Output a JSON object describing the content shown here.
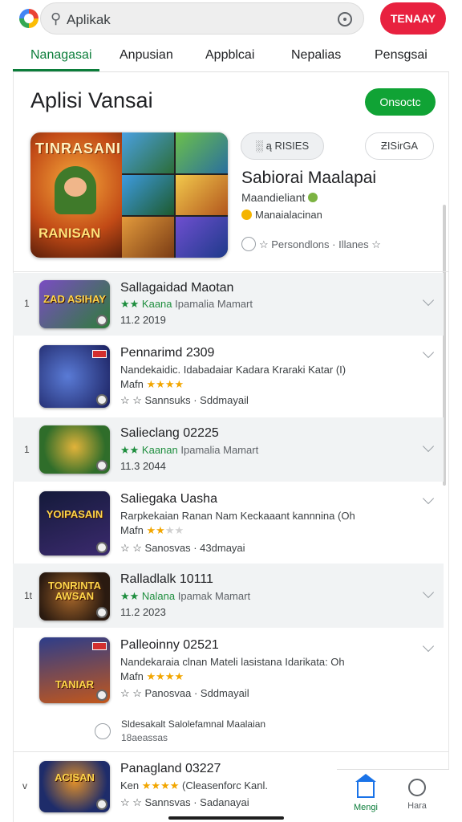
{
  "search": {
    "value": "Aplikak",
    "install_label": "TENAAY"
  },
  "tabs": [
    "Nanagasai",
    "Anpusian",
    "Appblcai",
    "Nepalias",
    "Pensgsai"
  ],
  "page": {
    "title": "Aplisi Vansai",
    "primary_button": "Onsoctc"
  },
  "featured": {
    "art_top": "TINRASANI",
    "art_bottom": "RANISAN",
    "pill_left": "░ ą RISIES",
    "pill_right": "ƵISirGA",
    "title": "Sabiorai Maalapai",
    "subtitle": "Maandieliant",
    "developer": "Manaialacinan",
    "meta": "☆  Persondlons  ·  Illanes ☆"
  },
  "list": [
    {
      "num": "1",
      "title": "Sallagaidad Maotan",
      "line1": "★★ Kaana",
      "line1b": "Ipamalia Mamart",
      "line2": "11.2 2019",
      "thumb": "ZAD ASIHAY"
    },
    {
      "num": "",
      "title": "Pennarimd 2309",
      "line1": "Nandekaidic. Idabadaiar Kadara Kraraki Katar (I)",
      "line1b": "",
      "stars_label": "Mafn",
      "stars": 4,
      "line2": "☆ ☆ Sannsuks  ·  Sddmayail",
      "thumb": ""
    },
    {
      "num": "1",
      "title": "Salieclang 02225",
      "line1": "★★ Kaanan",
      "line1b": "Ipamalia Mamart",
      "line2": "11.3 2044",
      "thumb": ""
    },
    {
      "num": "",
      "title": "Saliegaka Uasha",
      "line1": "Rarpkekaian Ranan Nam Keckaaant kannnina (Oh",
      "line1b": "",
      "stars_label": "Mafn",
      "stars": 2,
      "line2": "☆ ☆ Sanosvas  ·  43dmayai",
      "thumb": "YOIPASAIN"
    },
    {
      "num": "1t",
      "title": "Ralladlalk 10111",
      "line1": "★★ Nalana",
      "line1b": "Ipamak Mamart",
      "line2": "11.2 2023",
      "thumb": "TONRINTA AWSAN"
    },
    {
      "num": "",
      "title": "Palleoinny 02521",
      "line1": "Nandekaraia clnan Mateli lasistana Idarikata: Oh",
      "line1b": "",
      "stars_label": "Mafn",
      "stars": 4,
      "line2": "☆ ☆ Panosvaa  ·  Sddmayail",
      "thumb": "TANIAR"
    },
    {
      "num": "v",
      "title": "Panagland 03227",
      "line1": "Ken",
      "line1b": "(Cleasenforc Kanl.",
      "stars_label": "",
      "stars": 4,
      "line2": "☆ ☆ Sannsvas  ·  Sadanayai",
      "thumb": "ACISAN"
    }
  ],
  "loadmore": {
    "line1": "Sldesakalt Salolefamnal Maalaian",
    "line2": "18aeassas"
  },
  "bottom_nav": {
    "home_label": "Mengi",
    "other_label": "Hara"
  },
  "colors": {
    "accent_green": "#0b7d3a",
    "install_red": "#e8213f",
    "star": "#f2a600"
  }
}
